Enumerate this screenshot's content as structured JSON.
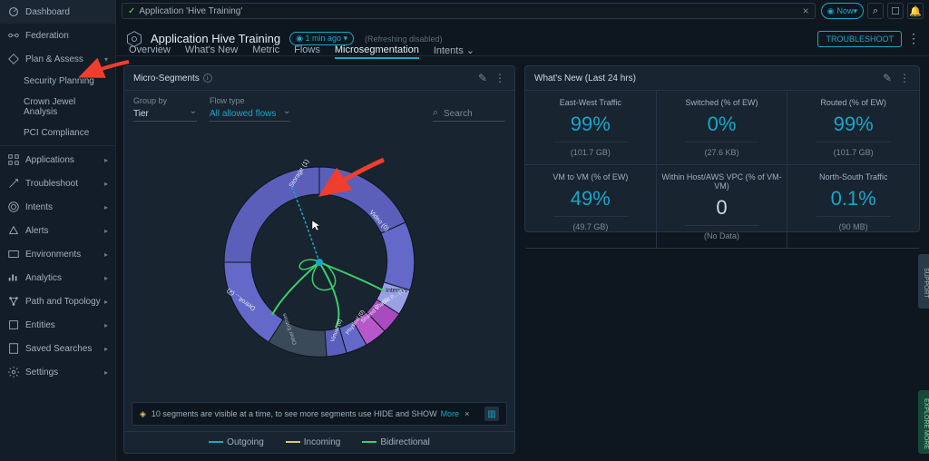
{
  "sidebar": {
    "items": [
      {
        "label": "Dashboard",
        "icon": "dashboard-icon",
        "expandable": false
      },
      {
        "label": "Federation",
        "icon": "federation-icon",
        "expandable": false
      },
      {
        "label": "Plan & Assess",
        "icon": "plan-assess-icon",
        "expandable": true
      },
      {
        "label": "Security Planning",
        "sub": true
      },
      {
        "label": "Crown Jewel Analysis",
        "sub": true
      },
      {
        "label": "PCI Compliance",
        "sub": true
      },
      {
        "label": "Applications",
        "icon": "applications-icon",
        "chev": true
      },
      {
        "label": "Troubleshoot",
        "icon": "troubleshoot-icon",
        "chev": true
      },
      {
        "label": "Intents",
        "icon": "intents-icon",
        "chev": true
      },
      {
        "label": "Alerts",
        "icon": "alerts-icon",
        "chev": true
      },
      {
        "label": "Environments",
        "icon": "environments-icon",
        "chev": true
      },
      {
        "label": "Analytics",
        "icon": "analytics-icon",
        "chev": true
      },
      {
        "label": "Path and Topology",
        "icon": "path-topology-icon",
        "chev": true
      },
      {
        "label": "Entities",
        "icon": "entities-icon",
        "chev": true
      },
      {
        "label": "Saved Searches",
        "icon": "saved-searches-icon",
        "chev": true
      },
      {
        "label": "Settings",
        "icon": "settings-icon",
        "chev": true
      }
    ]
  },
  "topbar": {
    "search_chip": "Application 'Hive Training'",
    "now_label": "Now"
  },
  "header": {
    "title": "Application Hive Training",
    "time_badge": "1 min ago",
    "refresh_text": "(Refreshing  disabled)",
    "troubleshoot": "TROUBLESHOOT"
  },
  "tabs": [
    "Overview",
    "What's New",
    "Metric",
    "Flows",
    "Microsegmentation",
    "Intents"
  ],
  "active_tab": 4,
  "left_panel": {
    "title": "Micro-Segments",
    "group_by_label": "Group by",
    "group_by_value": "Tier",
    "flow_type_label": "Flow type",
    "flow_type_value": "All allowed flows",
    "search_placeholder": "Search",
    "legend": {
      "outgoing": "Outgoing",
      "incoming": "Incoming",
      "bidirectional": "Bidirectional"
    },
    "hint_text": "10 segments are visible at a time, to see more segments use HIDE and SHOW",
    "hint_more": "More"
  },
  "right_panel": {
    "title": "What's New (Last 24 hrs)",
    "stats": [
      {
        "label": "East-West Traffic",
        "value": "99%",
        "sub": "(101.7 GB)"
      },
      {
        "label": "Switched (% of EW)",
        "value": "0%",
        "sub": "(27.6 KB)"
      },
      {
        "label": "Routed (% of EW)",
        "value": "99%",
        "sub": "(101.7 GB)"
      },
      {
        "label": "VM to VM (% of EW)",
        "value": "49%",
        "sub": "(49.7 GB)"
      },
      {
        "label": "Within Host/AWS VPC (% of VM-VM)",
        "value": "0",
        "sub": "(No Data)",
        "neutral": true
      },
      {
        "label": "North-South Traffic",
        "value": "0.1%",
        "sub": "(90 MB)"
      }
    ]
  },
  "chart_data": {
    "type": "donut",
    "segments": [
      {
        "label": "Storage (1)"
      },
      {
        "label": "Video (0)"
      },
      {
        "label": "Internet (215)"
      },
      {
        "label": "Shared P... (1)"
      },
      {
        "label": "Shared V... (0)"
      },
      {
        "label": "Physical (0)"
      },
      {
        "label": "Virtual (0)"
      },
      {
        "label": "Other Entities"
      },
      {
        "label": "Detroit... (2)"
      }
    ],
    "flow_lines": [
      {
        "type": "outgoing",
        "color": "#17a7c9"
      },
      {
        "type": "incoming",
        "color": "#e5c56b"
      },
      {
        "type": "bidirectional",
        "color": "#3bcf6b"
      }
    ]
  },
  "side_tabs": {
    "support": "SUPPORT",
    "explore": "EXPLORE MORE"
  }
}
